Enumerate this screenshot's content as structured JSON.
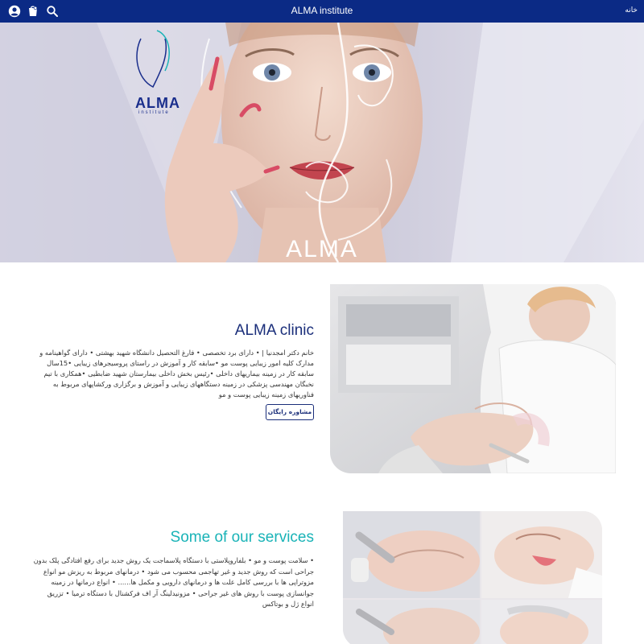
{
  "topbar": {
    "title": "ALMA institute",
    "home_label": "خانه",
    "icons": [
      "user-icon",
      "cart-icon",
      "search-icon"
    ],
    "bg_color": "#0b2a85"
  },
  "hero": {
    "logo_text": "ALMA",
    "logo_sub": "institute",
    "brand_text": "ALMA"
  },
  "clinic": {
    "title": "ALMA clinic",
    "description": "خانم دکتر امجدنیا | • دارای برد تخصصی • فارغ التحصیل دانشگاه شهید بهشتی • دارای گواهینامه و مدارک کلیه امور زیبایی پوست مو •سابقه کار و آموزش در راستای پروسیجرهای زیبایی •15سال سابقه کار در زمینه بیماریهای داخلی •رئیس بخش داخلی بیمارستان شهید ضابطیی •همکاری با تیم نخبگان مهندسی پزشکی در زمینه دستگاههای زیبایی و آموزش و برگزاری ورکشاپهای مربوط به فناوریهای زمینه زیبایی پوست و مو",
    "button_label": "مشاوره رایگان"
  },
  "services": {
    "title": "Some of our services",
    "description": "• سلامت پوست و مو • بلفاروپلاستی با دستگاه پلاسماجت یک روش جدید برای رفع افتادگی پلک بدون جراحی است که روش جدید و غیر تهاجمی محسوب می شود • درمانهای مربوط به ریزش مو انواع مزوتراپی ها با بررسی کامل علت ها و درمانهای دارویی و مکمل ها...... • انواع درمانها در زمینه جوانسازی پوست با روش های غیر جراحی • مزونیدلینگ آر اف فرکشنال با دستگاه ترمیا • تزریق انواع ژل و بوتاکس"
  },
  "colors": {
    "navy": "#1a2e7a",
    "teal": "#19b3b7"
  }
}
